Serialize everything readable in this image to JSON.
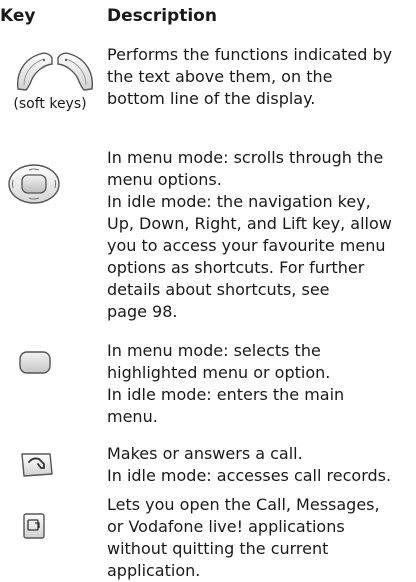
{
  "header": {
    "key_label": "Key",
    "description_label": "Description"
  },
  "rows": [
    {
      "icon": "soft-keys-icon",
      "caption": "(soft keys)",
      "lines": [
        "Performs the functions indicated by",
        "the text above them, on the",
        "bottom line of the display."
      ]
    },
    {
      "icon": "navigation-key-icon",
      "lines": [
        "In menu mode: scrolls through the",
        "menu options.",
        "In idle mode: the navigation key,",
        "Up, Down, Right, and Lift key, allow",
        "you to access your favourite menu",
        "options as shortcuts. For further",
        "details about shortcuts, see",
        "page 98."
      ]
    },
    {
      "icon": "select-key-icon",
      "lines": [
        "In menu mode: selects the",
        "highlighted menu or option.",
        "In idle mode: enters the main",
        "menu."
      ]
    },
    {
      "icon": "call-key-icon",
      "lines": [
        "Makes or answers a call.",
        "In idle mode: accesses call records."
      ]
    },
    {
      "icon": "application-key-icon",
      "lines": [
        "Lets you open the Call, Messages,",
        "or Vodafone live! applications",
        "without quitting the current",
        "application."
      ]
    }
  ]
}
